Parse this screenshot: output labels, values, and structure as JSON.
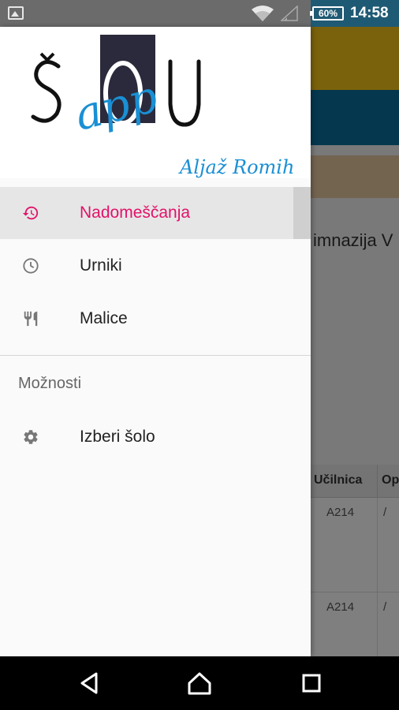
{
  "status_bar": {
    "battery": "60%",
    "time": "14:58",
    "icons": [
      "image-icon",
      "wifi-icon",
      "signal-icon",
      "battery-icon"
    ]
  },
  "drawer": {
    "logo": {
      "letters": "ŠOU",
      "word": "app",
      "signature": "Aljaž Romih"
    },
    "items": [
      {
        "label": "Nadomeščanja",
        "icon": "history-icon",
        "active": true
      },
      {
        "label": "Urniki",
        "icon": "clock-icon",
        "active": false
      },
      {
        "label": "Malice",
        "icon": "cutlery-icon",
        "active": false
      }
    ],
    "section_title": "Možnosti",
    "options": [
      {
        "label": "Izberi šolo",
        "icon": "gear-icon"
      }
    ]
  },
  "background_app": {
    "school_title": "imnazija V",
    "table_headers": [
      "Učilnica",
      "Op"
    ],
    "rows": [
      {
        "room": "A214",
        "op": "/"
      },
      {
        "room": "A214",
        "op": "/"
      }
    ]
  },
  "nav_bar": {
    "buttons": [
      "back-icon",
      "home-icon",
      "recents-icon"
    ]
  },
  "colors": {
    "accent": "#e2126a",
    "toolbar": "#f5c518",
    "tabs": "#0a6e9f",
    "logo_blue": "#1a8fd4"
  }
}
